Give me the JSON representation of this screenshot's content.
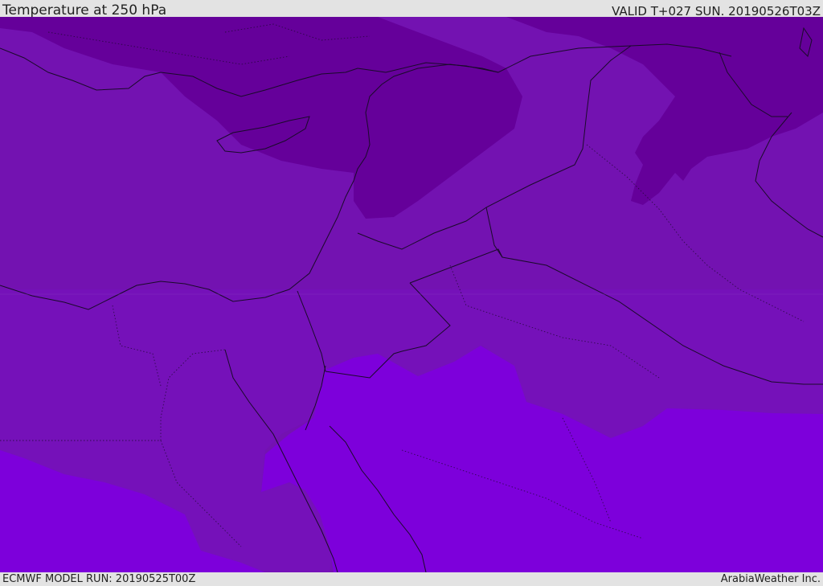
{
  "header": {
    "title": "Temperature at 250 hPa",
    "valid_time": "VALID T+027 SUN. 20190526T03Z"
  },
  "footer": {
    "model_run": "ECMWF MODEL RUN: 20190525T00Z",
    "credit": "ArabiaWeather Inc."
  },
  "map": {
    "fields": [
      {
        "name": "coldest-band",
        "color": "#65009a"
      },
      {
        "name": "cold-band",
        "color": "#7312b1"
      },
      {
        "name": "mid-band",
        "color": "#7511b9"
      },
      {
        "name": "warm-band",
        "color": "#7d00db"
      }
    ],
    "lines": {
      "coast": "#1a0a2a",
      "border": "#1a0a2a"
    }
  }
}
